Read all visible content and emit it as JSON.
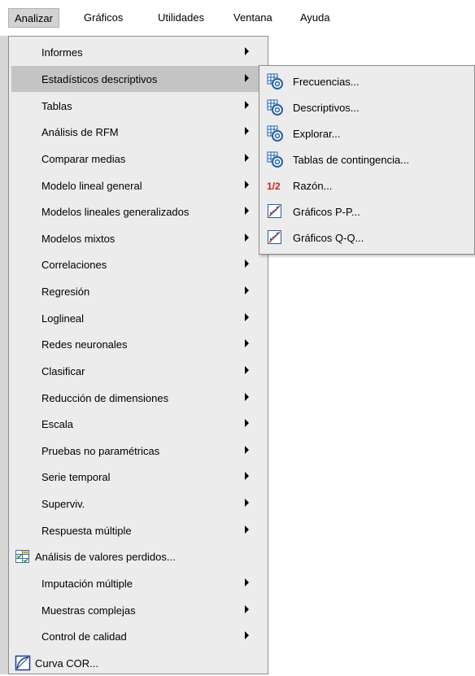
{
  "menubar": {
    "items": [
      {
        "label": "Analizar",
        "active": true
      },
      {
        "label": "Gráficos",
        "active": false
      },
      {
        "label": "Utilidades",
        "active": false
      },
      {
        "label": "Ventana",
        "active": false
      },
      {
        "label": "Ayuda",
        "active": false
      }
    ]
  },
  "analizar_menu": {
    "items": [
      {
        "label": "Informes",
        "submenu": true
      },
      {
        "label": "Estadísticos descriptivos",
        "submenu": true,
        "highlighted": true
      },
      {
        "label": "Tablas",
        "submenu": true
      },
      {
        "label": "Análisis de RFM",
        "submenu": true
      },
      {
        "label": "Comparar medias",
        "submenu": true
      },
      {
        "label": "Modelo lineal general",
        "submenu": true
      },
      {
        "label": "Modelos lineales generalizados",
        "submenu": true
      },
      {
        "label": "Modelos mixtos",
        "submenu": true
      },
      {
        "label": "Correlaciones",
        "submenu": true
      },
      {
        "label": "Regresión",
        "submenu": true
      },
      {
        "label": "Loglineal",
        "submenu": true
      },
      {
        "label": "Redes neuronales",
        "submenu": true
      },
      {
        "label": "Clasificar",
        "submenu": true
      },
      {
        "label": "Reducción de dimensiones",
        "submenu": true
      },
      {
        "label": "Escala",
        "submenu": true
      },
      {
        "label": "Pruebas no paramétricas",
        "submenu": true
      },
      {
        "label": "Serie temporal",
        "submenu": true
      },
      {
        "label": "Superviv.",
        "submenu": true
      },
      {
        "label": "Respuesta múltiple",
        "submenu": true
      },
      {
        "label": "Análisis de valores perdidos...",
        "submenu": false,
        "icon": "missing-values-icon"
      },
      {
        "label": "Imputación múltiple",
        "submenu": true
      },
      {
        "label": "Muestras complejas",
        "submenu": true
      },
      {
        "label": "Control de calidad",
        "submenu": true
      },
      {
        "label": "Curva COR...",
        "submenu": false,
        "icon": "roc-curve-icon"
      }
    ]
  },
  "descriptivos_submenu": {
    "items": [
      {
        "label": "Frecuencias...",
        "icon": "frequencies-icon"
      },
      {
        "label": "Descriptivos...",
        "icon": "descriptives-icon"
      },
      {
        "label": "Explorar...",
        "icon": "explore-icon"
      },
      {
        "label": "Tablas de contingencia...",
        "icon": "crosstabs-icon"
      },
      {
        "label": "Razón...",
        "icon": "ratio-icon"
      },
      {
        "label": "Gráficos P-P...",
        "icon": "pp-plot-icon"
      },
      {
        "label": "Gráficos Q-Q...",
        "icon": "qq-plot-icon"
      }
    ],
    "ratio_icon_text": "1/2"
  },
  "colors": {
    "menu_bg": "#ececec",
    "highlight": "#c4c4c4",
    "icon_blue": "#1f5fa8",
    "icon_red": "#d42020"
  }
}
